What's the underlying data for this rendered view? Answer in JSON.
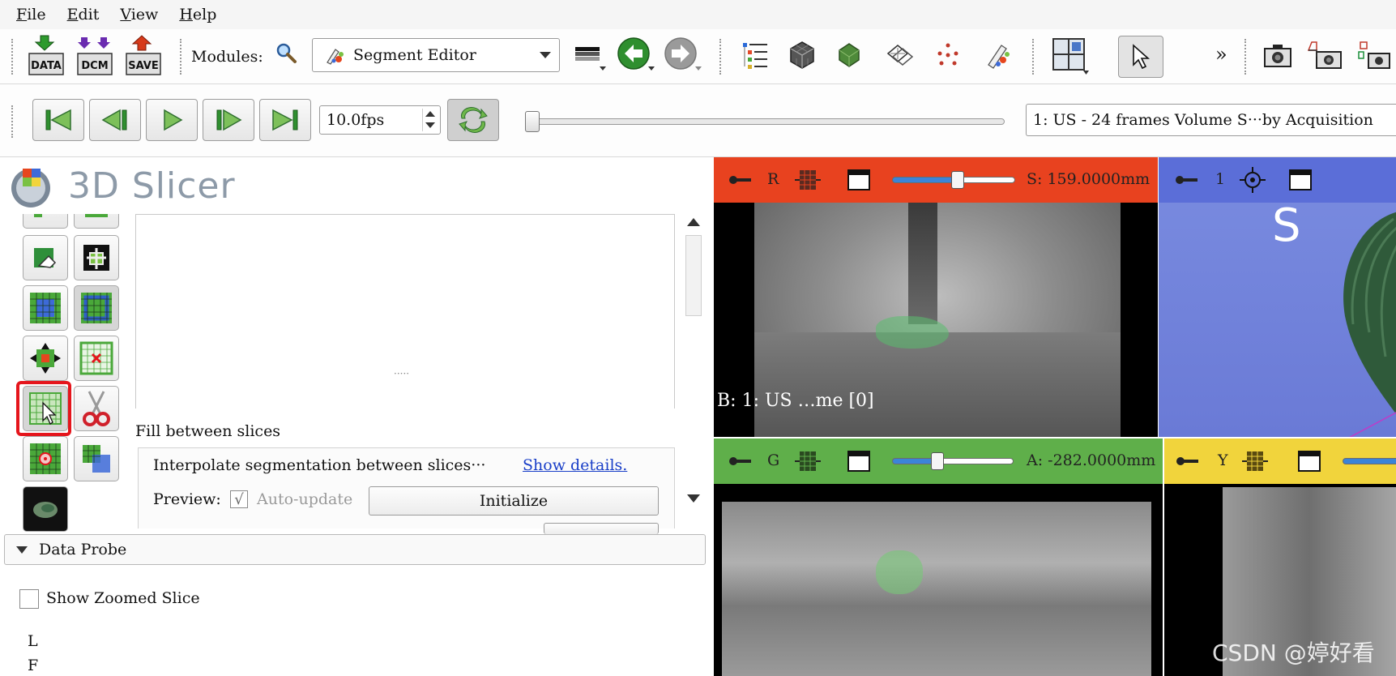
{
  "menu": {
    "items": [
      {
        "first": "F",
        "rest": "ile"
      },
      {
        "first": "E",
        "rest": "dit"
      },
      {
        "first": "V",
        "rest": "iew"
      },
      {
        "first": "H",
        "rest": "elp"
      }
    ]
  },
  "toolbar": {
    "data_label": "DATA",
    "dcm_label": "DCM",
    "save_label": "SAVE",
    "modules_label": "Modules:",
    "module_selected": "Segment Editor",
    "more_label": "»"
  },
  "sequence": {
    "fps": "10.0fps",
    "browser_selected": "1: US - 24 frames Volume S···by Acquisition"
  },
  "app": {
    "name": "3D Slicer"
  },
  "segment_editor": {
    "effect_title": "Fill between slices",
    "description": "Interpolate segmentation between slices···",
    "show_details": "Show details.",
    "preview_label": "Preview:",
    "auto_update_label": "Auto-update",
    "auto_update_check": "√",
    "initialize_label": "Initialize",
    "resize_grip": "·····"
  },
  "data_probe": {
    "title": "Data Probe",
    "show_zoomed_slice": "Show Zoomed Slice",
    "line1": "L",
    "line2": "F"
  },
  "viewers": {
    "red": {
      "label": "R",
      "offset": "S: 159.0000mm",
      "slider": 0.48,
      "overlay": "B: 1: US …me [0]",
      "color": "#e8421f"
    },
    "view3d": {
      "label": "1",
      "orientation": "S",
      "color": "#5b6ed8"
    },
    "green": {
      "label": "G",
      "offset": "A: -282.0000mm",
      "slider": 0.37,
      "color": "#5faf4a"
    },
    "yellow": {
      "label": "Y",
      "color": "#f1d43c"
    }
  },
  "watermark": "CSDN @婷好看"
}
